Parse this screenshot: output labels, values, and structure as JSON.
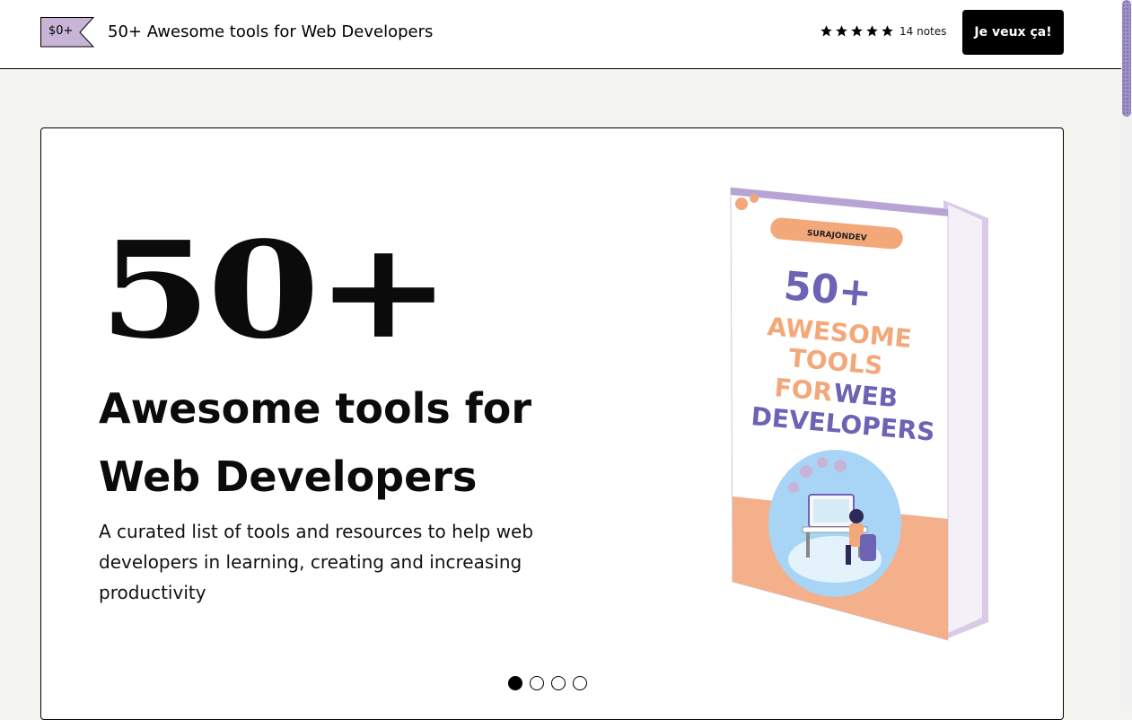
{
  "header": {
    "price": "$0+",
    "product_title": "50+ Awesome tools for Web Developers",
    "rating_count": "14 notes",
    "stars": 5,
    "buy_label": "Je veux ça!"
  },
  "hero": {
    "big_number": "50+",
    "heading": "Awesome tools for Web Developers",
    "description": "A curated list of tools and resources to help web developers in learning, creating and increasing productivity"
  },
  "cover": {
    "author": "SURAJONDEV",
    "line1": "50+",
    "line2": "AWESOME",
    "line3": "TOOLS",
    "line4a": "FOR",
    "line4b": "WEB",
    "line5": "DEVELOPERS"
  },
  "carousel": {
    "count": 4,
    "active_index": 0
  },
  "colors": {
    "accent_purple": "#6c63b5",
    "accent_orange": "#f3a87a",
    "tag_fill": "#c8b4d6"
  }
}
